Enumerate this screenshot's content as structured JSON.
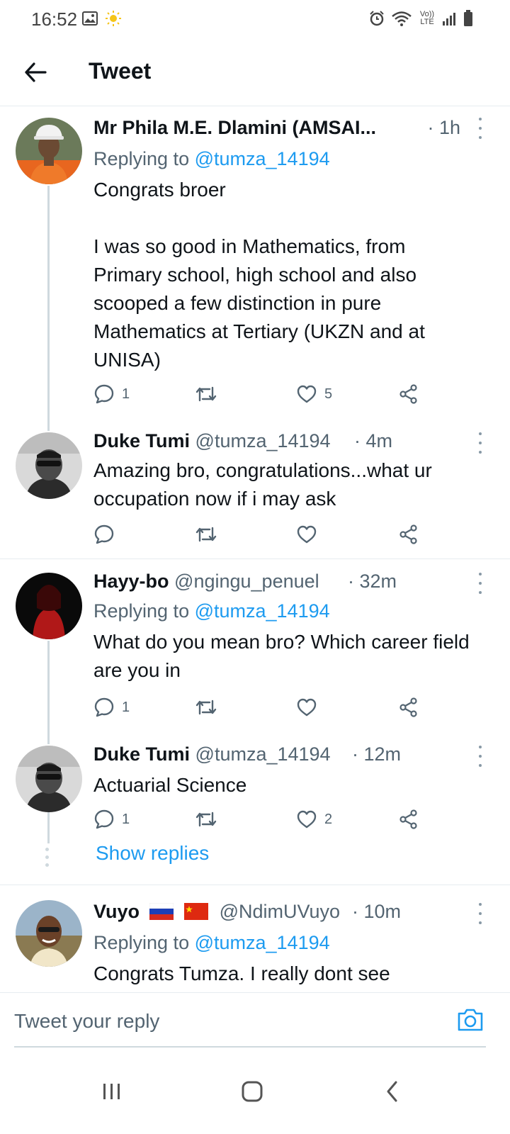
{
  "status_bar": {
    "time": "16:52",
    "network_label": "Vo)) LTE"
  },
  "header": {
    "title": "Tweet"
  },
  "colors": {
    "link": "#1d9bf0",
    "muted": "#536471",
    "text": "#0f1419"
  },
  "tweets": [
    {
      "name": "Mr Phila M.E. Dlamini (AMSAI...",
      "handle": "",
      "time": "· 1h",
      "replying_prefix": "Replying to ",
      "replying_to": "@tumza_14194",
      "text": "Congrats broer\n\nI was so good in Mathematics, from Primary school, high school and also scooped a few distinction in pure Mathematics at Tertiary (UKZN and at UNISA)",
      "reply_count": "1",
      "retweet_count": "",
      "like_count": "5"
    },
    {
      "name": "Duke Tumi",
      "handle": "@tumza_14194",
      "time": "· 4m",
      "text": "Amazing bro, congratulations...what ur occupation now if i may ask",
      "reply_count": "",
      "retweet_count": "",
      "like_count": ""
    },
    {
      "name": "Hayy-bo",
      "handle": "@ngingu_penuel",
      "time": "· 32m",
      "replying_prefix": "Replying to ",
      "replying_to": "@tumza_14194",
      "text": "What do you mean bro? Which career field are you in",
      "reply_count": "1",
      "retweet_count": "",
      "like_count": ""
    },
    {
      "name": "Duke Tumi",
      "handle": "@tumza_14194",
      "time": "· 12m",
      "text": "Actuarial Science",
      "reply_count": "1",
      "retweet_count": "",
      "like_count": "2"
    },
    {
      "name": "Vuyo",
      "handle": "@NdimUVuyo",
      "time": "· 10m",
      "flags": [
        "russia-flag-icon",
        "china-flag-icon"
      ],
      "replying_prefix": "Replying to ",
      "replying_to": "@tumza_14194",
      "text": "Congrats Tumza. I really dont see"
    }
  ],
  "show_replies": "Show replies",
  "reply_bar": {
    "placeholder": "Tweet your reply",
    "camera_icon": "camera-icon"
  },
  "nav_bar": {
    "buttons": [
      "recents-icon",
      "home-icon",
      "back-icon"
    ]
  }
}
